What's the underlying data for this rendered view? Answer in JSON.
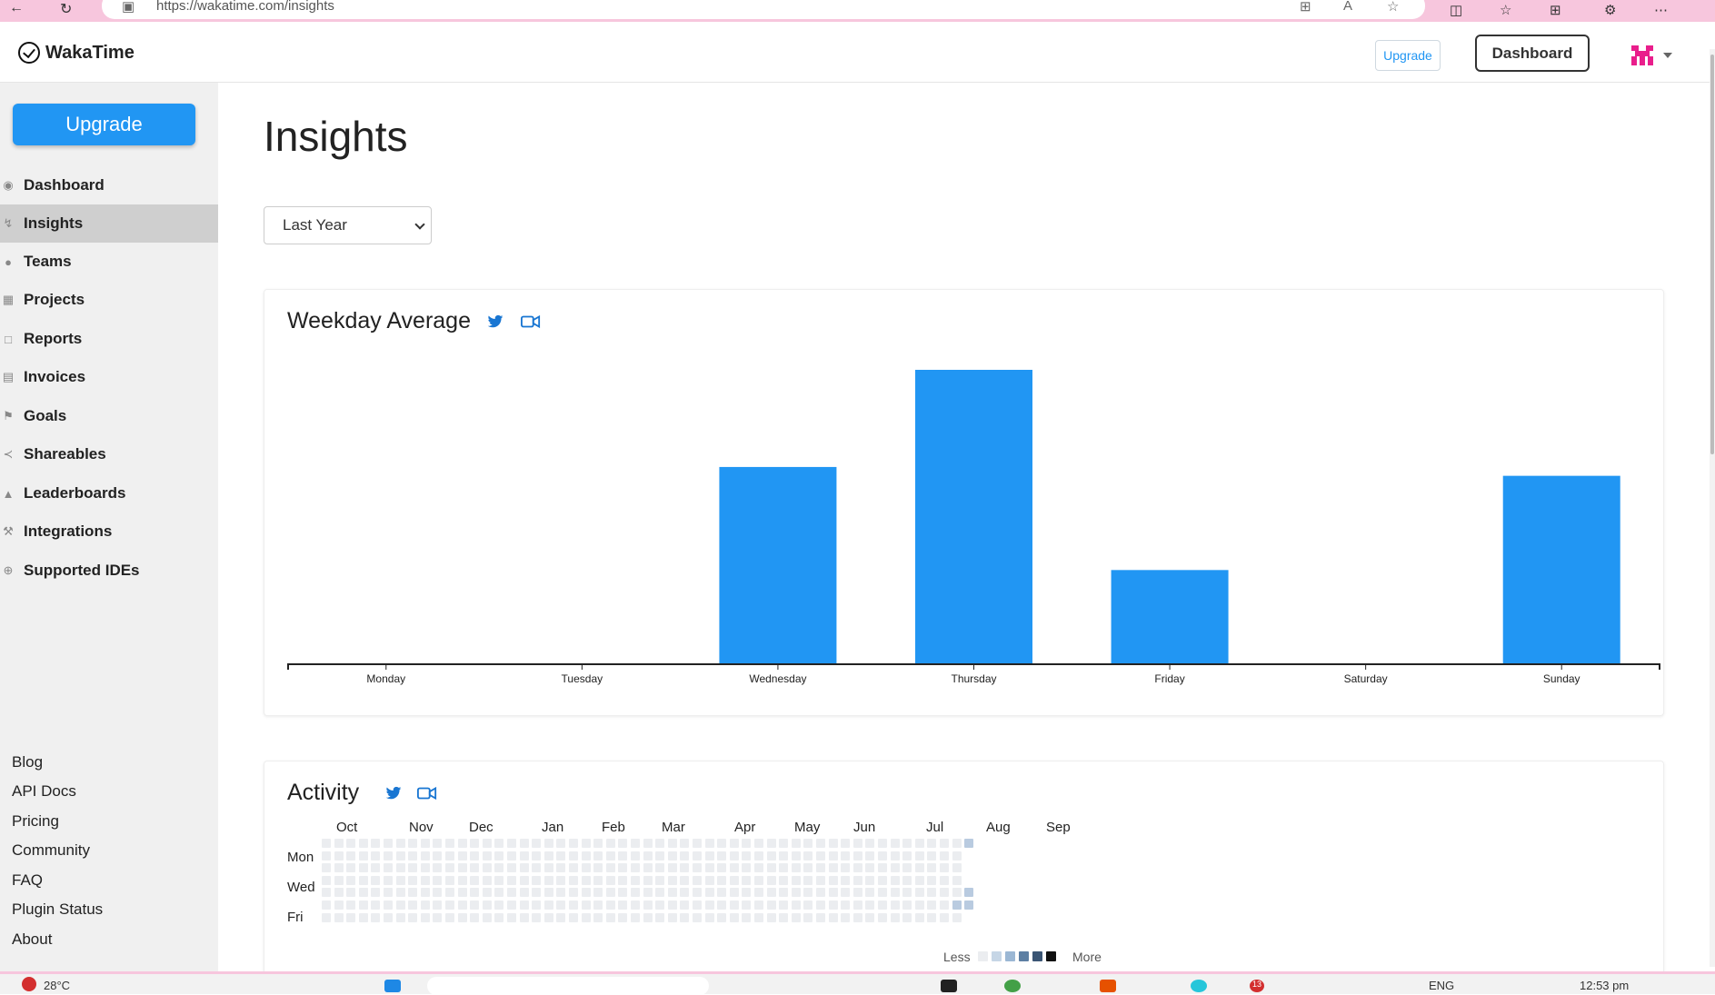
{
  "browser": {
    "url": "https://wakatime.com/insights",
    "icons": [
      "back-arrow-icon",
      "refresh-icon",
      "site-info-icon",
      "app-icon",
      "read-aloud-icon",
      "favorite-star-icon",
      "split-screen-icon",
      "favorites-icon",
      "collections-icon",
      "extension-icon",
      "more-icon"
    ]
  },
  "header": {
    "brand": "WakaTime",
    "upgrade_label": "Upgrade",
    "dashboard_label": "Dashboard"
  },
  "sidebar": {
    "upgrade_label": "Upgrade",
    "items": [
      {
        "label": "Dashboard",
        "icon": "palette-icon",
        "active": false
      },
      {
        "label": "Insights",
        "icon": "bolt-icon",
        "active": true
      },
      {
        "label": "Teams",
        "icon": "users-icon",
        "active": false
      },
      {
        "label": "Projects",
        "icon": "grid-icon",
        "active": false
      },
      {
        "label": "Reports",
        "icon": "report-icon",
        "active": false
      },
      {
        "label": "Invoices",
        "icon": "invoice-icon",
        "active": false
      },
      {
        "label": "Goals",
        "icon": "flag-icon",
        "active": false
      },
      {
        "label": "Shareables",
        "icon": "share-icon",
        "active": false
      },
      {
        "label": "Leaderboards",
        "icon": "trophy-icon",
        "active": false
      },
      {
        "label": "Integrations",
        "icon": "wrench-icon",
        "active": false
      },
      {
        "label": "Supported IDEs",
        "icon": "plus-circle-icon",
        "active": false
      }
    ],
    "footer_links": [
      "Blog",
      "API Docs",
      "Pricing",
      "Community",
      "FAQ",
      "Plugin Status",
      "About"
    ]
  },
  "main": {
    "title": "Insights",
    "range_select": "Last Year"
  },
  "weekday_card": {
    "title": "Weekday Average"
  },
  "chart_data": {
    "type": "bar",
    "title": "Weekday Average",
    "categories": [
      "Monday",
      "Tuesday",
      "Wednesday",
      "Thursday",
      "Friday",
      "Saturday",
      "Sunday"
    ],
    "values": [
      0,
      0,
      0.67,
      1.0,
      0.32,
      0,
      0.64
    ],
    "ylim": [
      0,
      1.0
    ],
    "bar_color": "#2196f3",
    "grid": false
  },
  "activity_card": {
    "title": "Activity",
    "months": [
      "Oct",
      "Nov",
      "Dec",
      "Jan",
      "Feb",
      "Mar",
      "Apr",
      "May",
      "Jun",
      "Jul",
      "Aug",
      "Sep"
    ],
    "days": [
      "Mon",
      "Wed",
      "Fri"
    ],
    "legend_less": "Less",
    "legend_more": "More",
    "legend_colors": [
      "#ebedf0",
      "#c6d6e6",
      "#9bb7d4",
      "#5d7fa3",
      "#3a5574",
      "#111111"
    ]
  },
  "taskbar": {
    "weather": "28°C",
    "lang": "ENG",
    "time": "12:53 pm",
    "badge_count": "13"
  }
}
